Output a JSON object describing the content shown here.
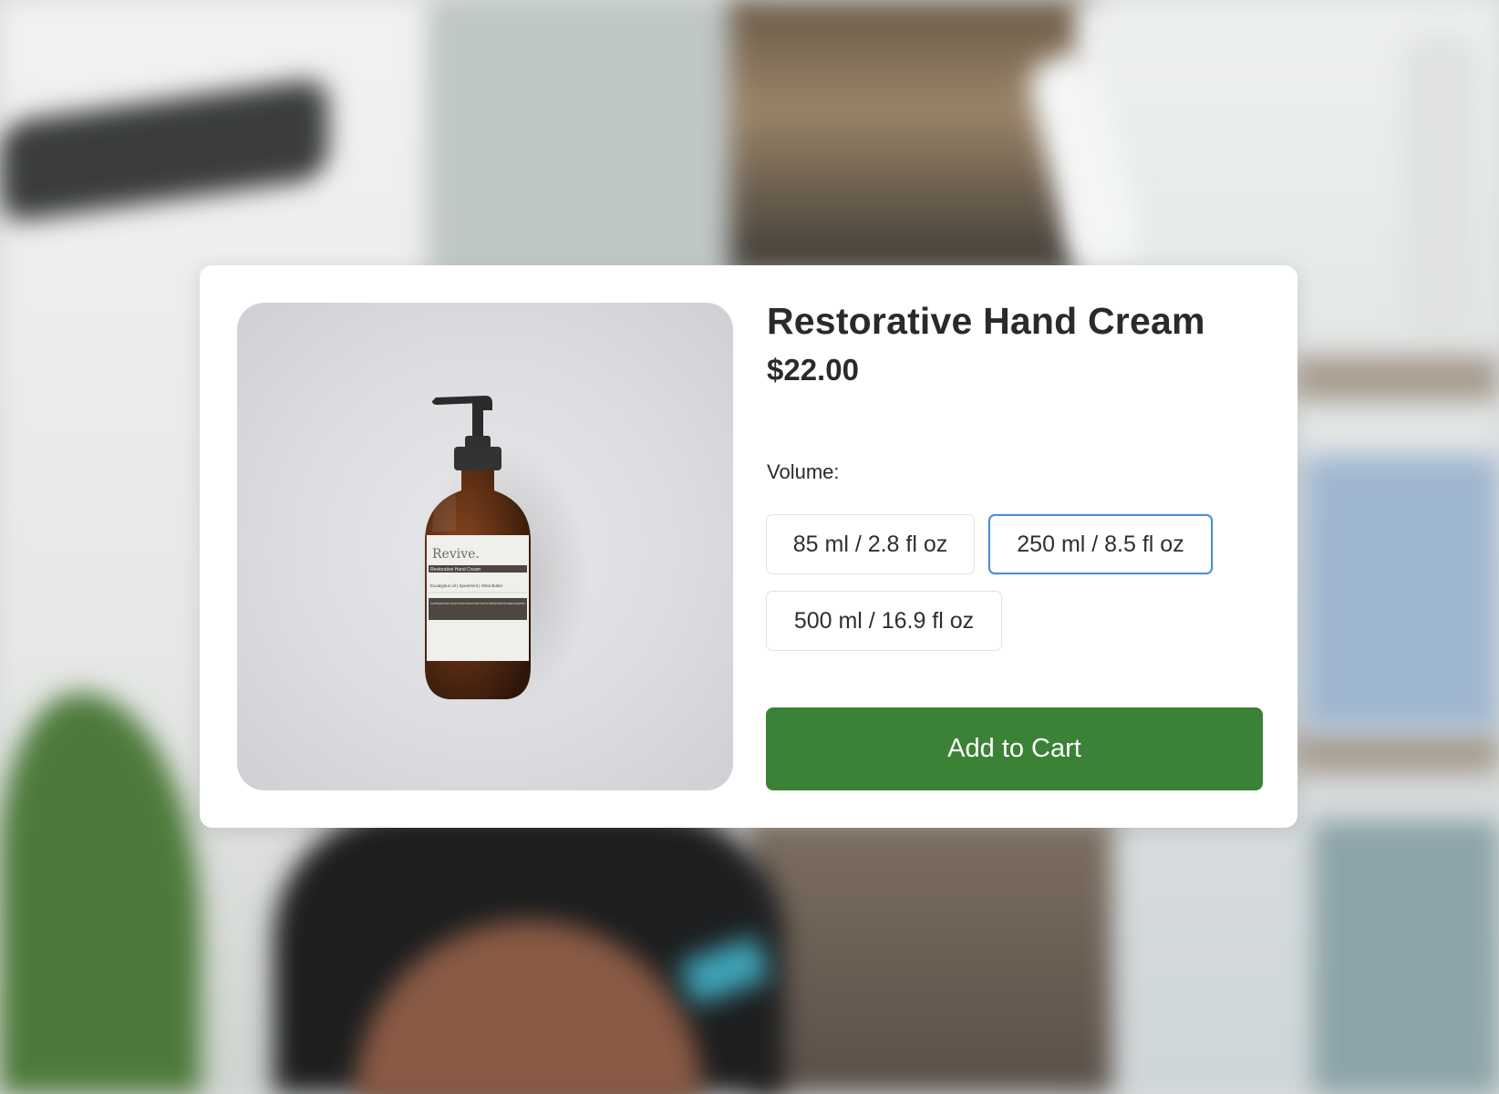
{
  "product": {
    "title": "Restorative Hand Cream",
    "price": "$22.00",
    "image": {
      "brand": "Revive.",
      "label_subtitle": "Restorative Hand Cream",
      "label_ingredients": "Eucalyptus oil | Spearmint | Shea Butter",
      "label_description": "A nourishing hand cream for dry skin. Use when hands are in need of some love. Naturally scented with eucalyptus and spearmint."
    }
  },
  "volume": {
    "label": "Volume:",
    "options": [
      {
        "label": "85 ml / 2.8 fl oz",
        "selected": false
      },
      {
        "label": "250 ml / 8.5 fl oz",
        "selected": true
      },
      {
        "label": "500 ml / 16.9 fl oz",
        "selected": false
      }
    ]
  },
  "actions": {
    "add_to_cart_label": "Add to Cart"
  },
  "colors": {
    "primary_button": "#3b8136",
    "selected_border": "#4a90d9",
    "text": "#2a2a2a"
  }
}
